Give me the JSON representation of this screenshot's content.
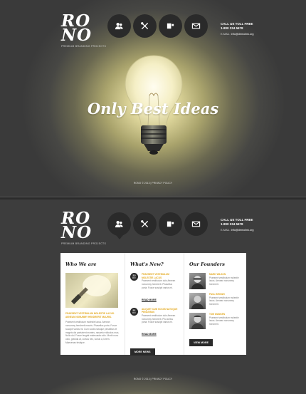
{
  "site": {
    "logo_line1": "RO",
    "logo_line2": "NO",
    "tagline": "PREMIUM BRANDING PROJECTS",
    "call_label": "CALL US TOLL FREE",
    "phone": "1-800 234 5678",
    "email_label": "E-MAIL:",
    "email": "info@demolink.org"
  },
  "nav": [
    {
      "icon": "users-icon",
      "label": "About"
    },
    {
      "icon": "tools-icon",
      "label": "Services"
    },
    {
      "icon": "book-icon",
      "label": "Portfolio"
    },
    {
      "icon": "mail-icon",
      "label": "Contacts"
    }
  ],
  "hero": {
    "headline": "Only Best Ideas",
    "footer": "RONO © 2013 | PRIVACY POLICY"
  },
  "content": {
    "who": {
      "title": "Who We are",
      "highlight": "PRAESENT VESTIBULUM MOLESTIE LACUS. AENEAN NONUMMY HENDRERIT MAURIS.",
      "text": "Praesent vestibulum molestie lacus. Aenean nonummy hendrerit mauris. Phasellus porta. Fusce suscipit varius mi. Cum sociis natoque penatibus et magnis dis parturient montes, nascetur ridiculus mus. Nulla dui. Fusce feugiat malesuada odio. Morbi nunc odio, gravida at, cursus nec, luctus a, lorem. Maecenas tristique."
    },
    "news": {
      "title": "What's New?",
      "items": [
        {
          "day": "22",
          "month": "MAY",
          "heading": "PRAESENT VESTIBULUM MOLESTIE LACUS",
          "text": "Praesent vestibulum duis Aenean nonummy hendrerit. Phasellus porta. Fusce suscipit varius mi.",
          "more": "READ MORE"
        },
        {
          "day": "21",
          "month": "MAY",
          "heading": "ALIQUET CUM SOCIIS NATOQUE PENATIBUS",
          "text": "Praesent vestibulum duis Aenean nonummy hendrerit. Pha sellus porta. Fusce suscipit varius mi.",
          "more": "READ MORE"
        }
      ],
      "button": "MORE NEWS"
    },
    "founders": {
      "title": "Our Founders",
      "items": [
        {
          "name": "MARK WILSON",
          "text": "Praesent vestibulum molestie lacus. Aenean nonummy hendrerit."
        },
        {
          "name": "PAUL BROWN",
          "text": "Praesent vestibulum molestie lacus. Aenean nonummy hendrerit."
        },
        {
          "name": "TOM WANKEN",
          "text": "Praesent vestibulum molestie lacus. Aenean nonummy hendrerit."
        }
      ],
      "button": "VIEW MORE"
    },
    "footer": "RONO © 2013 | PRIVACY POLICY"
  }
}
